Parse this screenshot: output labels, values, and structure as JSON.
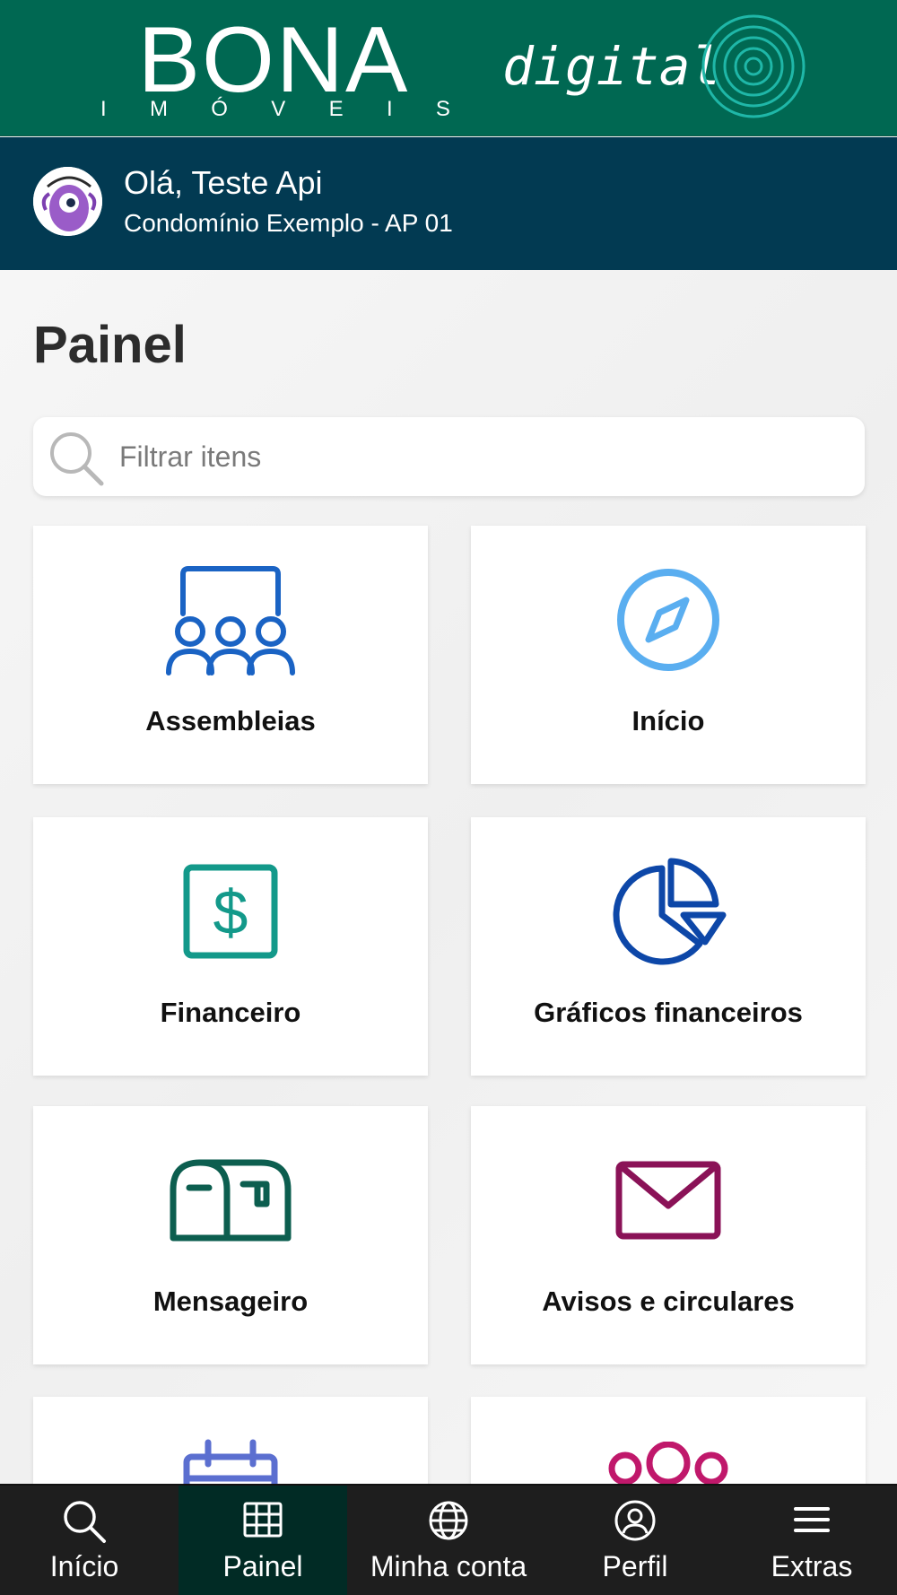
{
  "header": {
    "brand_name": "BONA",
    "brand_sub": [
      "I",
      "M",
      "Ó",
      "V",
      "E",
      "I",
      "S"
    ],
    "brand_digital": "digital"
  },
  "user": {
    "greeting": "Olá, Teste Api",
    "unit": "Condomínio Exemplo - AP 01"
  },
  "page": {
    "title": "Painel",
    "search_placeholder": "Filtrar itens"
  },
  "tiles": [
    {
      "label": "Assembleias",
      "icon": "assembly-icon",
      "color": "#1a63c4"
    },
    {
      "label": "Início",
      "icon": "compass-icon",
      "color": "#5aaef0"
    },
    {
      "label": "Financeiro",
      "icon": "dollar-icon",
      "color": "#13998a"
    },
    {
      "label": "Gráficos financeiros",
      "icon": "pie-chart-icon",
      "color": "#0d47a8"
    },
    {
      "label": "Mensageiro",
      "icon": "mailbox-icon",
      "color": "#0c5e4f"
    },
    {
      "label": "Avisos e circulares",
      "icon": "envelope-icon",
      "color": "#8a1257"
    },
    {
      "label": "",
      "icon": "calendar-icon",
      "color": "#5b6fd0"
    },
    {
      "label": "",
      "icon": "group-icon",
      "color": "#c0186b"
    }
  ],
  "nav": [
    {
      "label": "Início",
      "icon": "search-icon"
    },
    {
      "label": "Painel",
      "icon": "grid-icon",
      "active": true
    },
    {
      "label": "Minha conta",
      "icon": "globe-icon"
    },
    {
      "label": "Perfil",
      "icon": "user-circle-icon"
    },
    {
      "label": "Extras",
      "icon": "menu-icon"
    }
  ],
  "colors": {
    "header_green": "#006852",
    "userbar_navy": "#023a52",
    "navbar_dark": "#1e1e1e",
    "nav_active": "#012b25"
  }
}
